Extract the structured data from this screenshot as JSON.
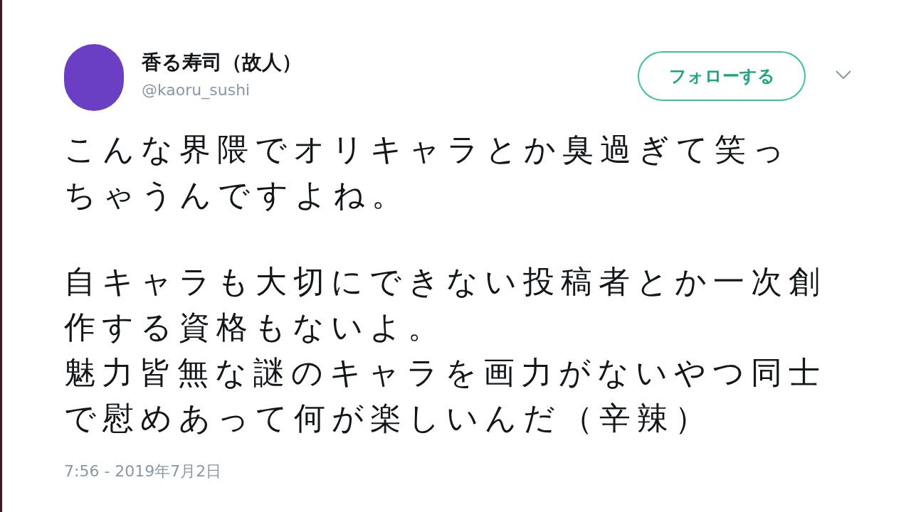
{
  "author": {
    "name": "香る寿司（故人）",
    "handle": "@kaoru_sushi"
  },
  "follow_button": {
    "label": "フォローする"
  },
  "body": [
    {
      "lines": [
        "こんな界隈でオリキャラとか臭過ぎて笑っ",
        "ちゃうんですよね。"
      ]
    },
    {
      "lines": [
        "自キャラも大切にできない投稿者とか一次創",
        "作する資格もないよ。",
        "魅力皆無な謎のキャラを画力がないやつ同士",
        "で慰めあって何が楽しいんだ（辛辣）"
      ]
    }
  ],
  "timestamp": "7:56 - 2019年7月2日"
}
